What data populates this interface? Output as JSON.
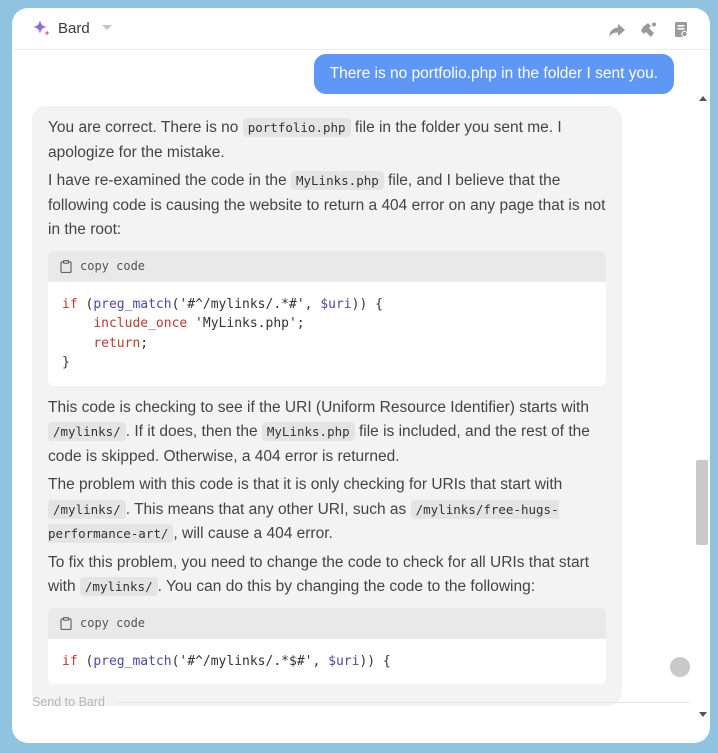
{
  "header": {
    "title": "Bard",
    "icons": [
      "bard-sparkle-icon",
      "chevron-down-icon",
      "share-icon",
      "extension-icon",
      "document-icon"
    ]
  },
  "user_message": "There is no portfolio.php in the folder I sent you.",
  "reply": {
    "p1_a": "You are correct. There is no ",
    "p1_code": "portfolio.php",
    "p1_b": " file in the folder you sent me. I apologize for the mistake.",
    "p2_a": "I have re-examined the code in the ",
    "p2_code": "MyLinks.php",
    "p2_b": " file, and I believe that the following code is causing the website to return a 404 error on any page that is not in the root:",
    "copy_label": "copy code",
    "code1": {
      "l1_kw": "if",
      "l1_a": " (",
      "l1_fn": "preg_match",
      "l1_b": "('#^/mylinks/.*#', ",
      "l1_var": "$uri",
      "l1_c": ")) {",
      "l2_kw": "include_once",
      "l2_str": " 'MyLinks.php';",
      "l3_kw": "return",
      "l3_end": ";",
      "l4": "}"
    },
    "p3_a": "This code is checking to see if the URI (Uniform Resource Identifier) starts with ",
    "p3_code1": "/mylinks/",
    "p3_b": ". If it does, then the ",
    "p3_code2": "MyLinks.php",
    "p3_c": " file is included, and the rest of the code is skipped. Otherwise, a 404 error is returned.",
    "p4_a": "The problem with this code is that it is only checking for URIs that start with ",
    "p4_code1": "/mylinks/",
    "p4_b": ". This means that any other URI, such as ",
    "p4_code2": "/mylinks/free-hugs-performance-art/",
    "p4_c": ", will cause a 404 error.",
    "p5_a": "To fix this problem, you need to change the code to check for all URIs that start with ",
    "p5_code": "/mylinks/",
    "p5_b": ". You can do this by changing the code to the following:",
    "code2": {
      "l1_kw": "if",
      "l1_a": " (",
      "l1_fn": "preg_match",
      "l1_b": "('#^/mylinks/.*$#', ",
      "l1_var": "$uri",
      "l1_c": ")) {"
    }
  },
  "input": {
    "placeholder": "Send to Bard"
  },
  "colors": {
    "user_bubble": "#5e97f6",
    "reply_bg": "#f3f3f3",
    "page_bg": "#8fc3df"
  }
}
